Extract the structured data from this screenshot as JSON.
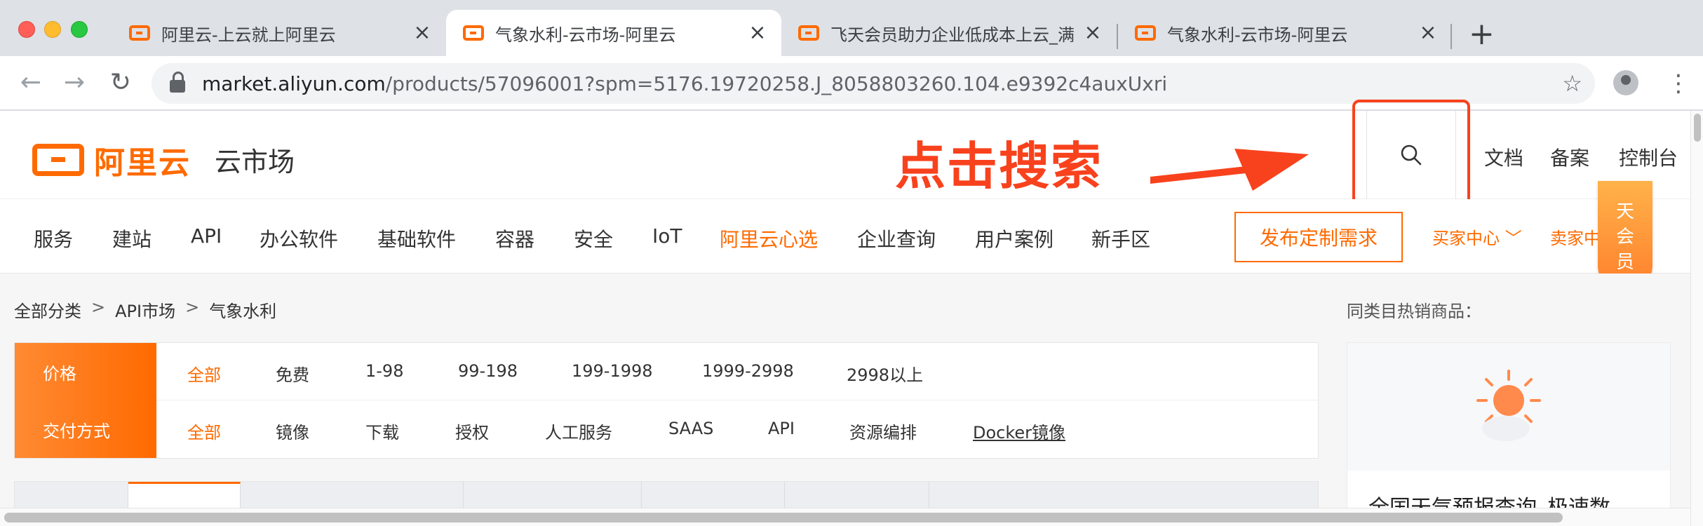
{
  "browser": {
    "tabs": [
      {
        "title": "阿里云-上云就上阿里云",
        "close": "×"
      },
      {
        "title": "气象水利-云市场-阿里云",
        "close": "×"
      },
      {
        "title": "飞天会员助力企业低成本上云_满",
        "close": "×"
      },
      {
        "title": "气象水利-云市场-阿里云",
        "close": "×"
      }
    ],
    "new_tab": "+",
    "url_host": "market.aliyun.com",
    "url_path": "/products/57096001?spm=5176.19720258.J_8058803260.104.e9392c4auxUxri",
    "star": "☆",
    "menu": "⋮",
    "back": "←",
    "forward": "→",
    "reload": "↻"
  },
  "header": {
    "logo_text": "阿里云",
    "market_title": "云市场",
    "annotation": "点击搜索",
    "links": [
      "文档",
      "备案",
      "控制台"
    ]
  },
  "nav": {
    "items": [
      "服务",
      "建站",
      "API",
      "办公软件",
      "基础软件",
      "容器",
      "安全",
      "IoT",
      "阿里云心选",
      "企业查询",
      "用户案例",
      "新手区"
    ],
    "publish": "发布定制需求",
    "buyer": "买家中心 ﹀",
    "seller": "卖家中",
    "member_lines": [
      "天",
      "会",
      "员"
    ]
  },
  "breadcrumb": [
    "全部分类",
    ">",
    "API市场",
    ">",
    "气象水利"
  ],
  "filters": {
    "price": {
      "label": "价格",
      "options": [
        "全部",
        "免费",
        "1-98",
        "99-198",
        "199-1998",
        "1999-2998",
        "2998以上"
      ]
    },
    "delivery": {
      "label": "交付方式",
      "options": [
        "全部",
        "镜像",
        "下载",
        "授权",
        "人工服务",
        "SAAS",
        "API",
        "资源编排",
        "Docker镜像"
      ]
    }
  },
  "sidebar": {
    "title": "同类目热销商品：",
    "card_text": "全国天气预报查询_极速数"
  },
  "colors": {
    "brand": "#ff6a00",
    "annotation": "#f8421d"
  }
}
